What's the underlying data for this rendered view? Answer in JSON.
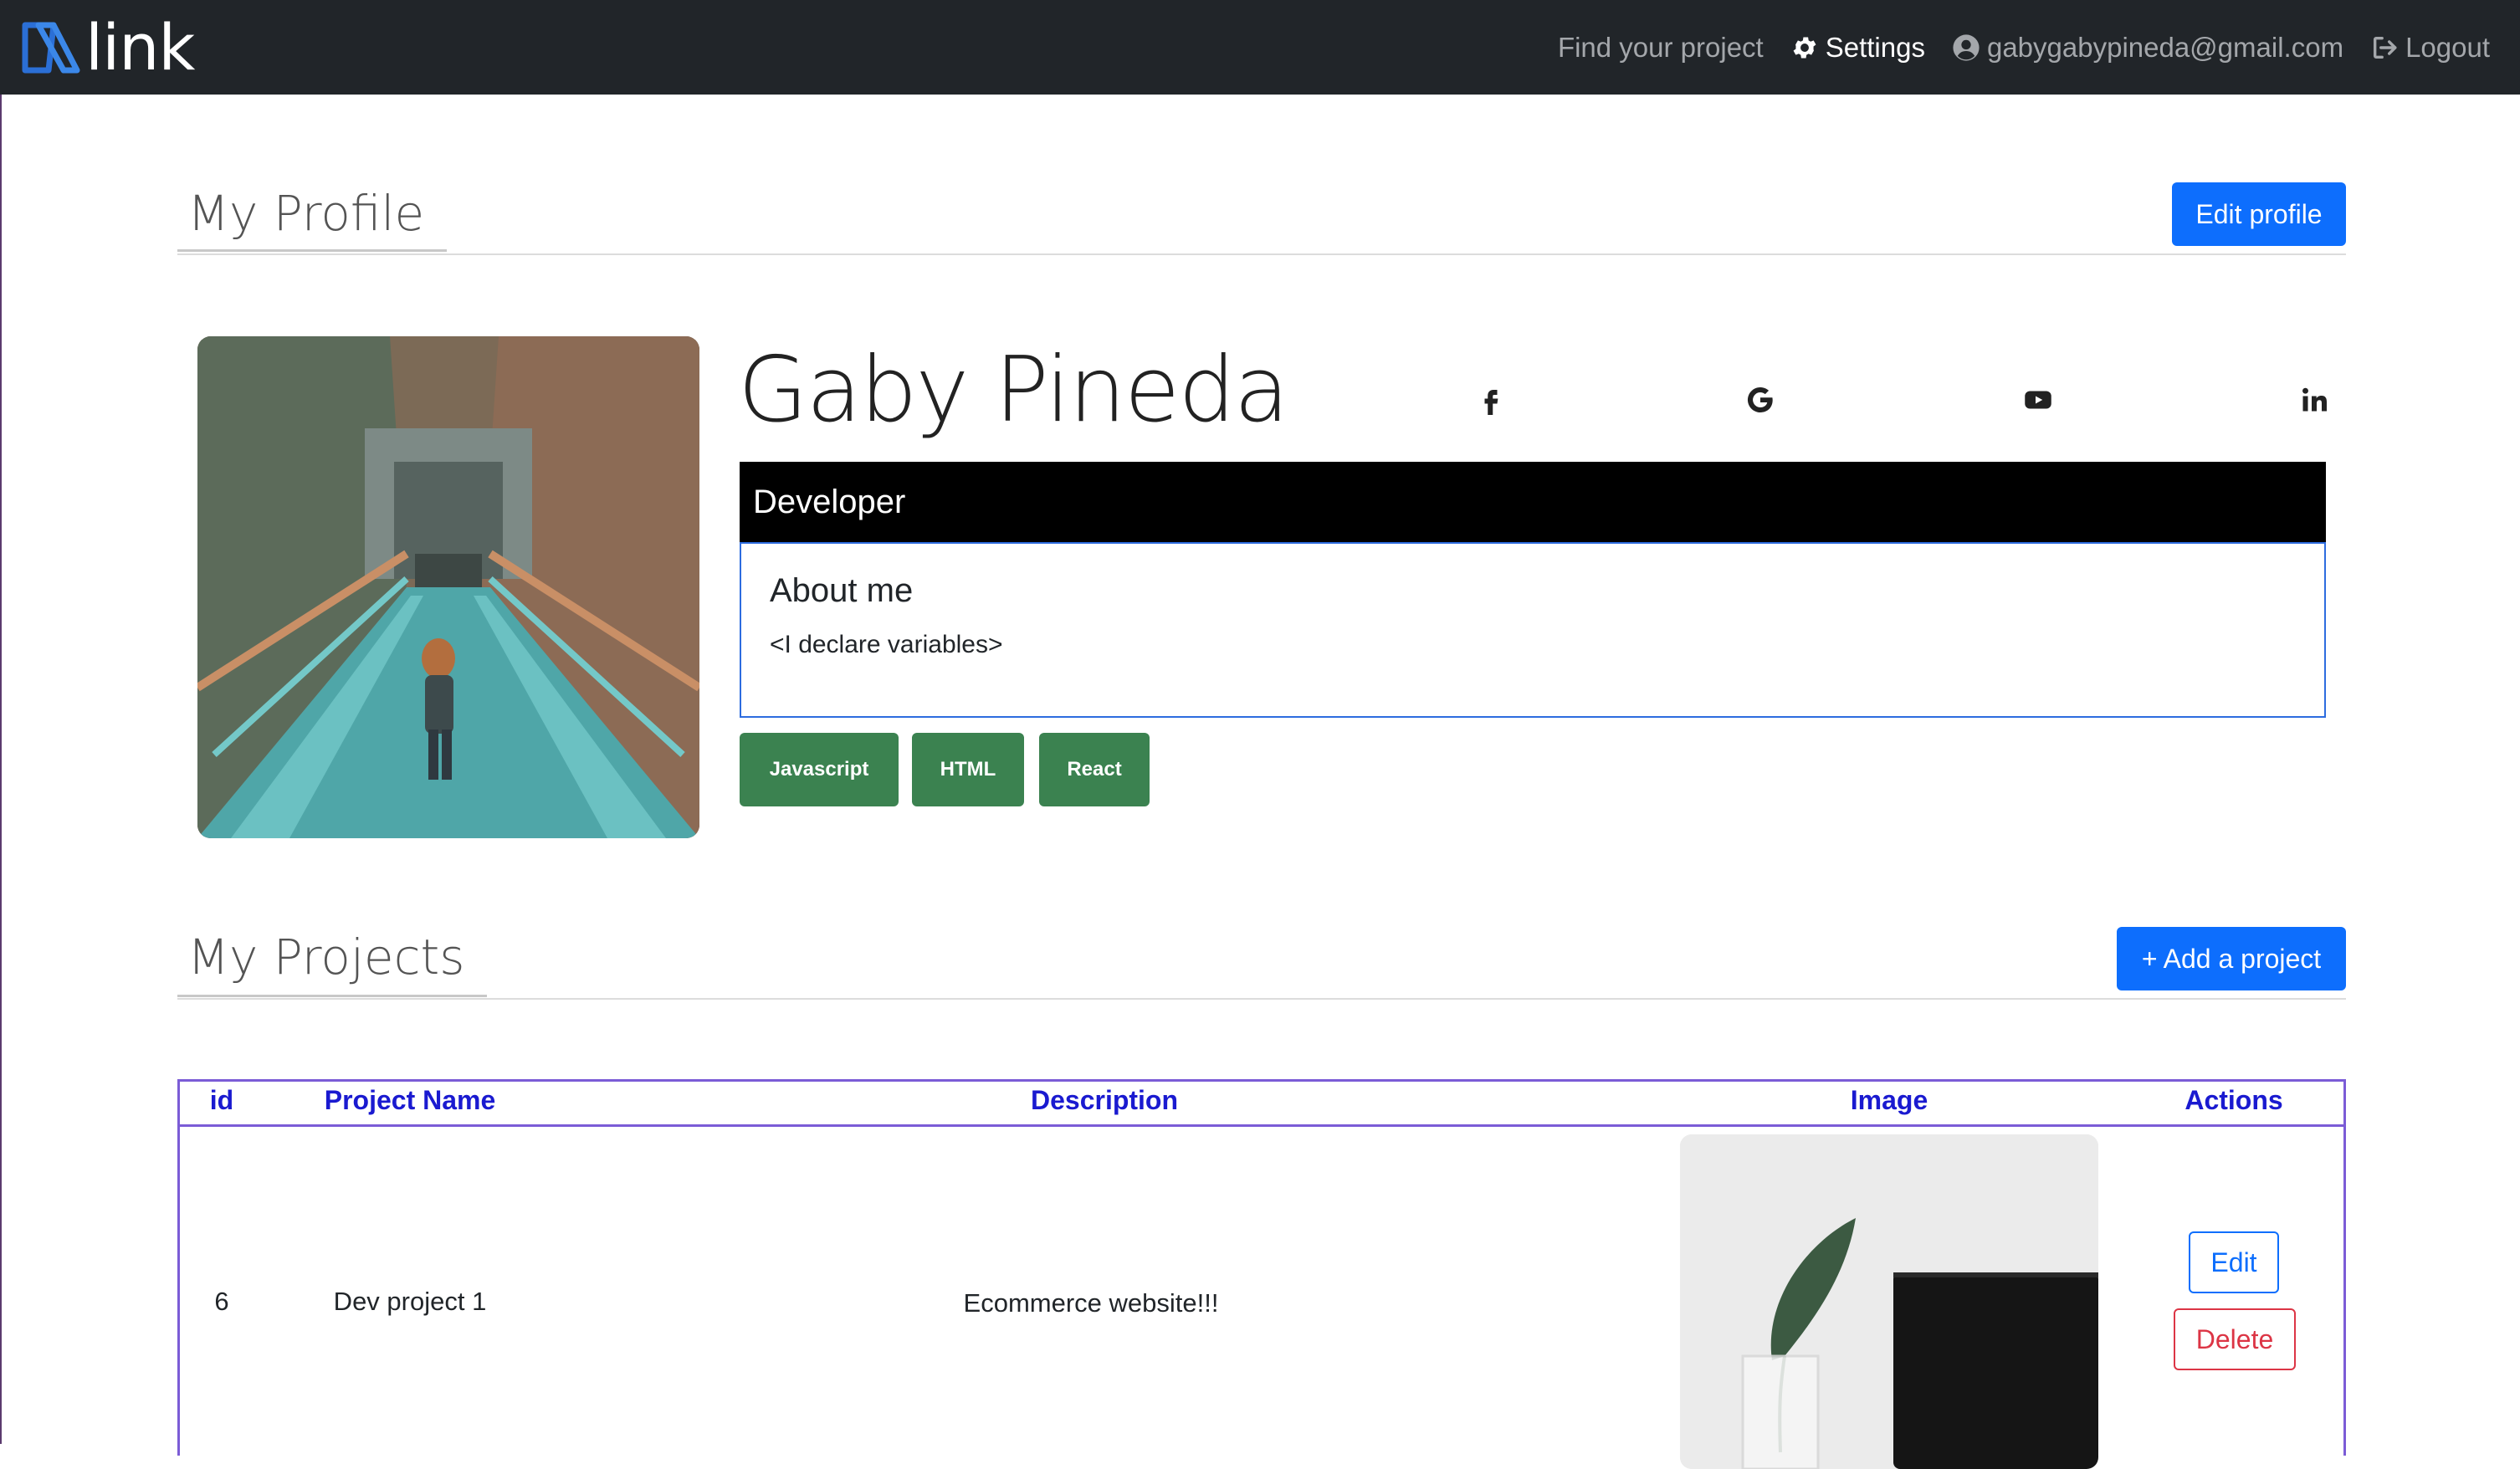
{
  "navbar": {
    "brand": "link",
    "links": {
      "find_project": "Find your project",
      "settings": "Settings",
      "email": "gabygabypineda@gmail.com",
      "logout": "Logout"
    }
  },
  "profile_section": {
    "title": "My Profile",
    "edit_button": "Edit profile"
  },
  "profile": {
    "name": "Gaby Pineda",
    "role": "Developer",
    "about_title": "About me",
    "about_text": "<I declare variables>",
    "skills": [
      "Javascript",
      "HTML",
      "React"
    ],
    "social_icons": [
      "facebook-icon",
      "google-icon",
      "youtube-icon",
      "linkedin-icon"
    ]
  },
  "projects_section": {
    "title": "My Projects",
    "add_button": "+ Add a project"
  },
  "table": {
    "headers": [
      "id",
      "Project Name",
      "Description",
      "Image",
      "Actions"
    ],
    "rows": [
      {
        "id": "6",
        "name": "Dev project 1",
        "description": "Ecommerce website!!!",
        "actions": {
          "edit": "Edit",
          "delete": "Delete"
        }
      }
    ]
  },
  "colors": {
    "navbar_bg": "#212529",
    "primary": "#0d6efd",
    "skill_badge": "#3b8250",
    "danger": "#dc3545",
    "table_border": "#7b5cd6",
    "table_header_text": "#1a1ad0"
  }
}
